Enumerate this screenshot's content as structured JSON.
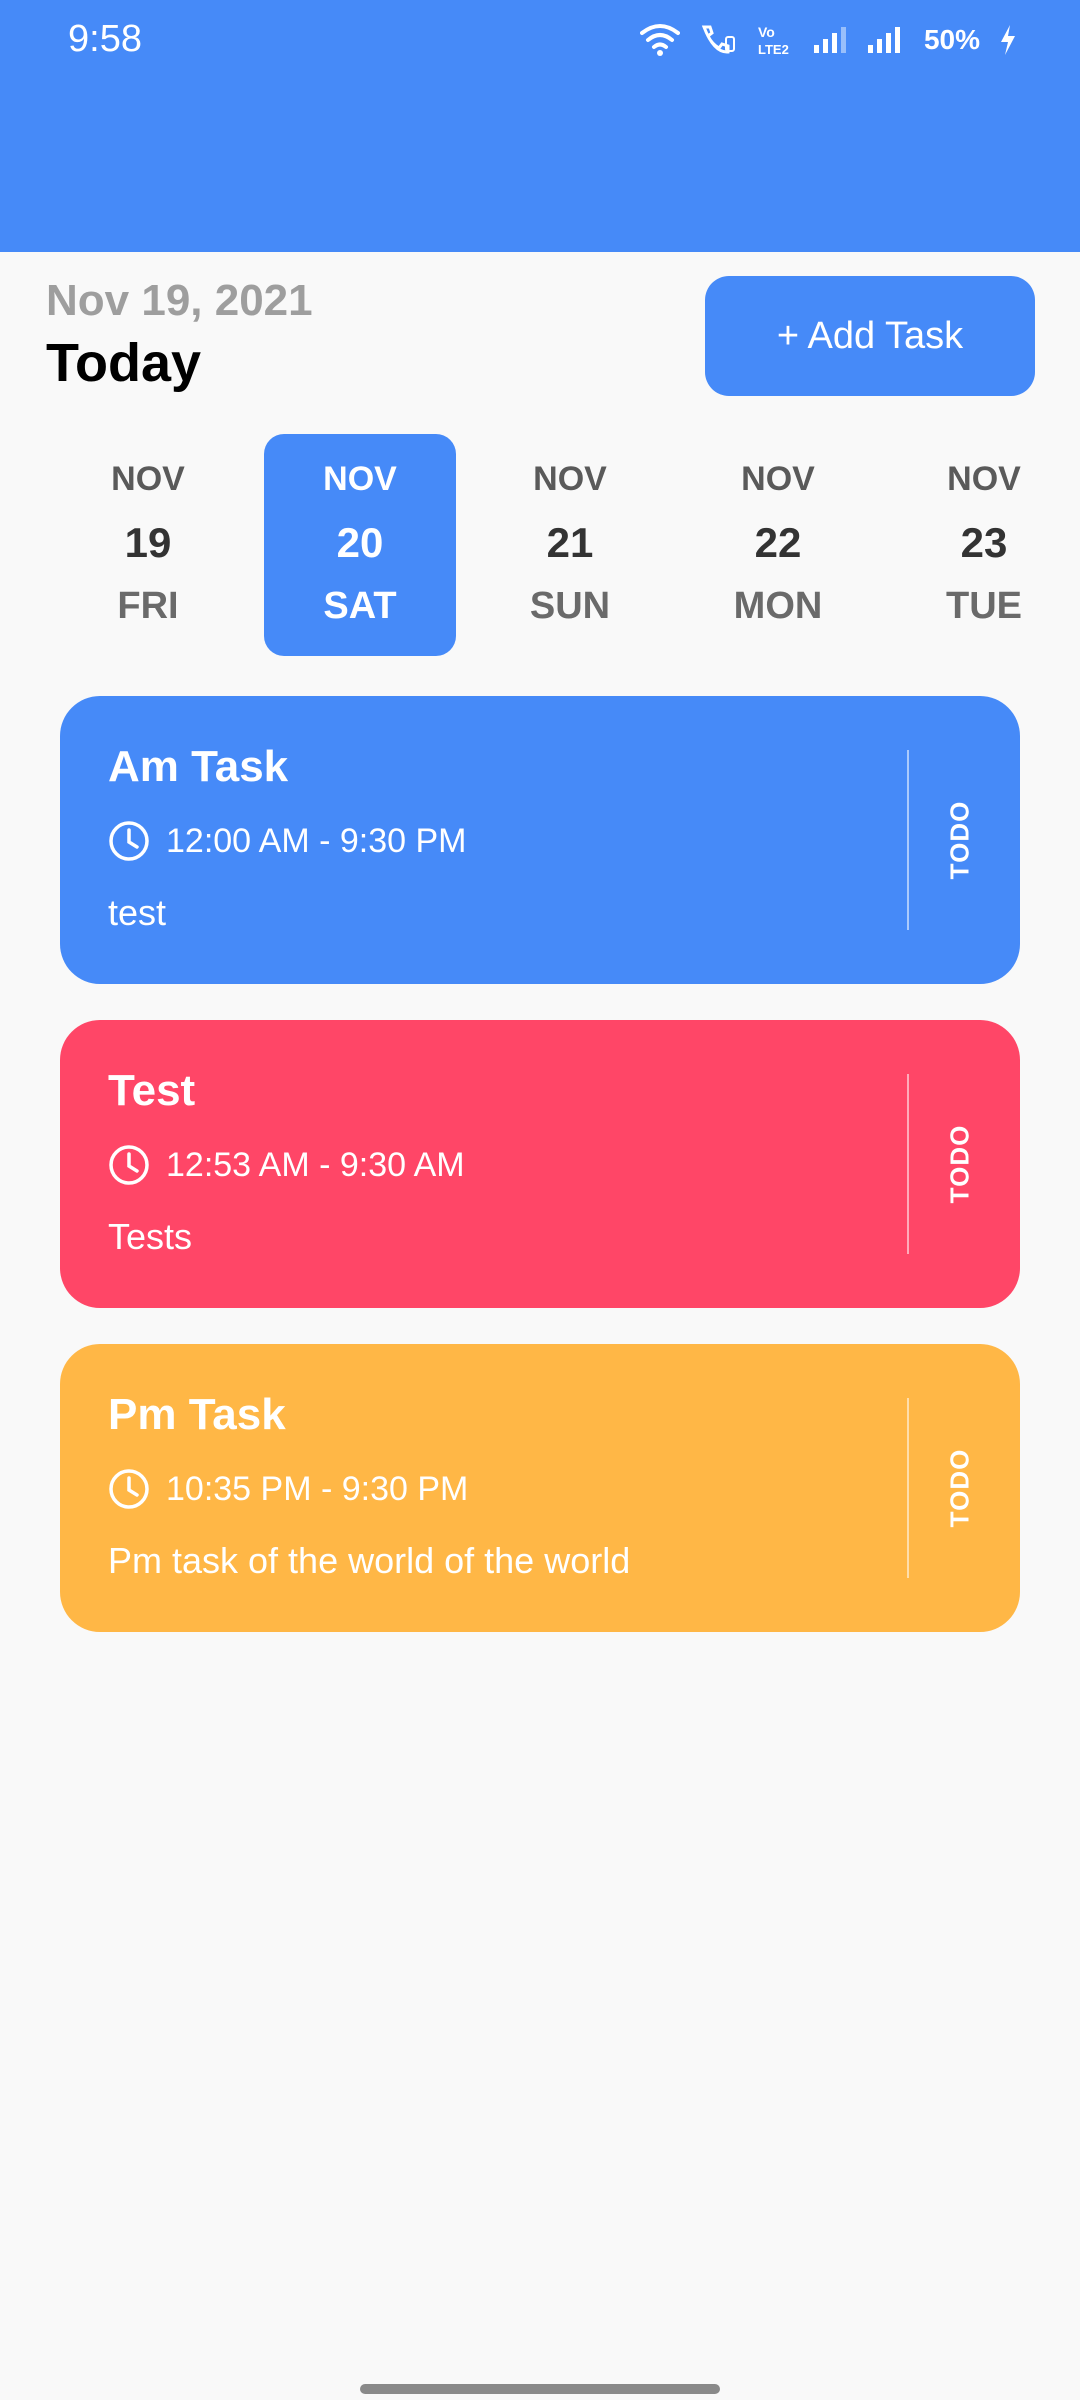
{
  "status_bar": {
    "time": "9:58",
    "battery": "50%"
  },
  "header": {
    "date": "Nov 19, 2021",
    "today": "Today",
    "add_task_label": "+ Add Task"
  },
  "date_picker": [
    {
      "month": "NOV",
      "day": "19",
      "weekday": "FRI",
      "selected": false
    },
    {
      "month": "NOV",
      "day": "20",
      "weekday": "SAT",
      "selected": true
    },
    {
      "month": "NOV",
      "day": "21",
      "weekday": "SUN",
      "selected": false
    },
    {
      "month": "NOV",
      "day": "22",
      "weekday": "MON",
      "selected": false
    },
    {
      "month": "NOV",
      "day": "23",
      "weekday": "TUE",
      "selected": false
    }
  ],
  "tasks": [
    {
      "title": "Am Task",
      "time": "12:00 AM - 9:30 PM",
      "description": "test",
      "status": "TODO",
      "color": "#468af8"
    },
    {
      "title": "Test",
      "time": "12:53 AM - 9:30 AM",
      "description": "Tests",
      "status": "TODO",
      "color": "#ff4667"
    },
    {
      "title": "Pm Task",
      "time": "10:35 PM - 9:30 PM",
      "description": "Pm task of the world of the world",
      "status": "TODO",
      "color": "#ffb746"
    }
  ],
  "colors": {
    "primary": "#468af8",
    "pink": "#ff4667",
    "yellow": "#ffb746",
    "background": "#f9f9f9"
  },
  "icons": {
    "theme_toggle": "moon-icon",
    "time": "clock-icon"
  }
}
